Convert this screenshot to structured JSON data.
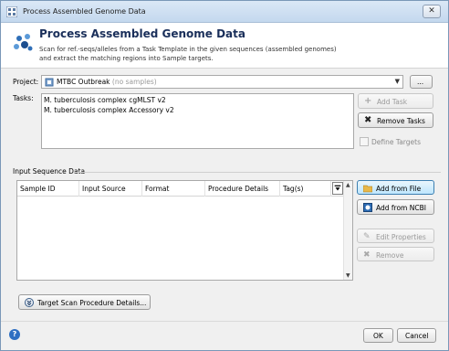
{
  "window": {
    "title": "Process Assembled Genome Data",
    "close_glyph": "✕"
  },
  "header": {
    "title": "Process Assembled Genome Data",
    "description_line1": "Scan for ref.-seqs/alleles from a Task Template in the given sequences (assembled genomes)",
    "description_line2": "and extract the matching regions into Sample targets."
  },
  "project": {
    "label": "Project:",
    "value": "MTBC Outbreak",
    "value_suffix": "(no samples)",
    "browse_label": "..."
  },
  "tasks": {
    "label": "Tasks:",
    "items": [
      "M. tuberculosis complex cgMLST v2",
      "M. tuberculosis complex Accessory v2"
    ],
    "add_label": "Add Task",
    "remove_label": "Remove Tasks",
    "define_targets_label": "Define Targets"
  },
  "input": {
    "group_title": "Input Sequence Data",
    "columns": [
      "Sample ID",
      "Input Source",
      "Format",
      "Procedure Details",
      "Tag(s)"
    ],
    "add_file_label": "Add from File",
    "add_ncbi_label": "Add from NCBI",
    "edit_label": "Edit Properties",
    "remove_label": "Remove"
  },
  "procedure_button_label": "Target Scan Procedure Details...",
  "footer": {
    "ok_label": "OK",
    "cancel_label": "Cancel",
    "help_glyph": "?"
  },
  "colors": {
    "title_text": "#1a2f5a",
    "accent": "#3c7fb1"
  }
}
